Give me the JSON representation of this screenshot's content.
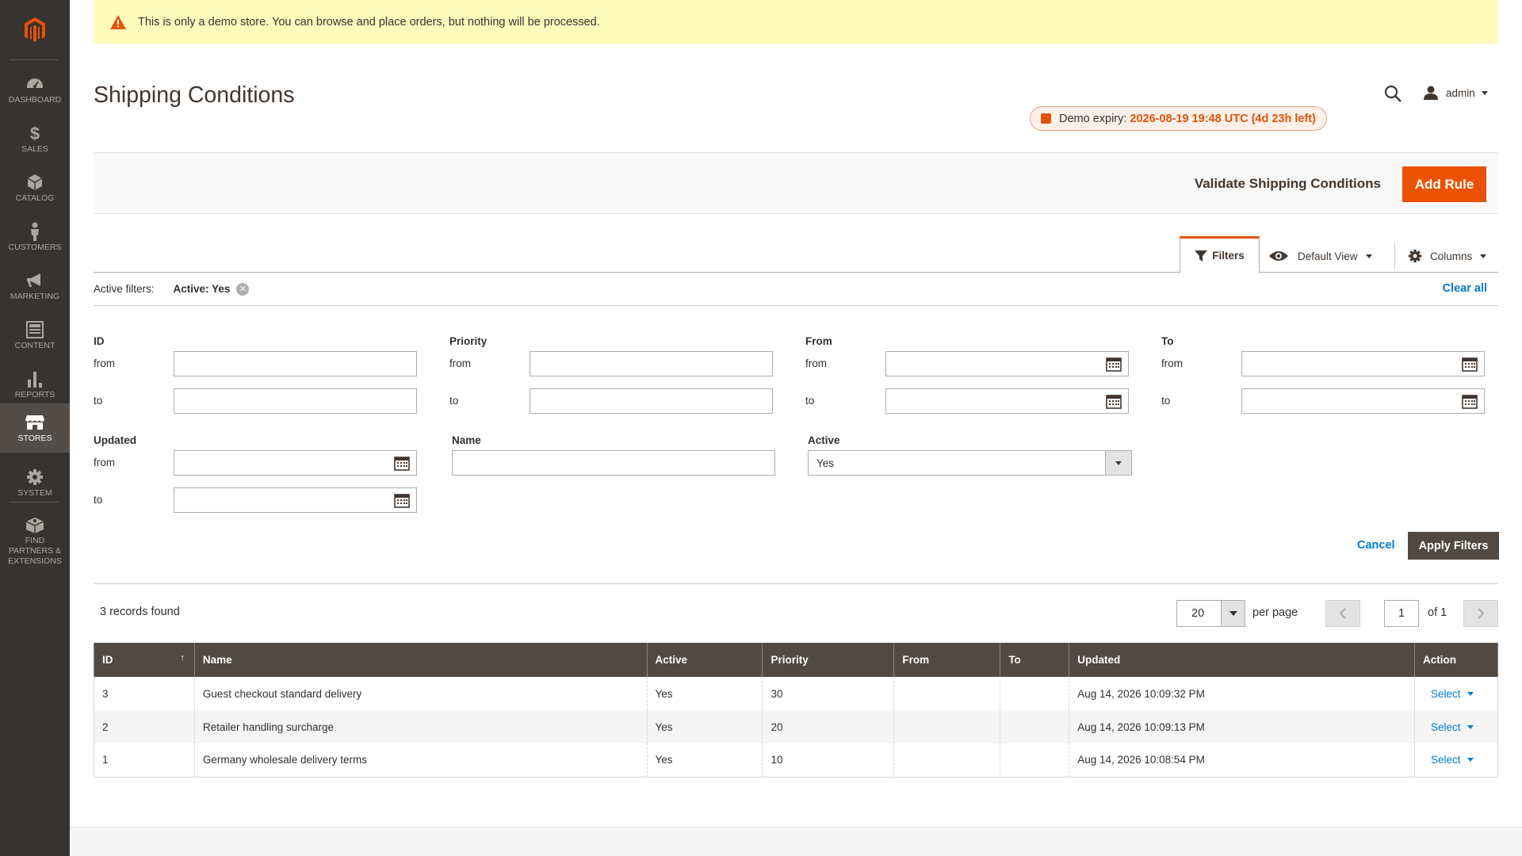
{
  "banner": {
    "text": "This is only a demo store. You can browse and place orders, but nothing will be processed."
  },
  "nav": [
    {
      "label": "DASHBOARD",
      "icon": "dashboard-icon"
    },
    {
      "label": "SALES",
      "icon": "dollar-icon"
    },
    {
      "label": "CATALOG",
      "icon": "cube-icon"
    },
    {
      "label": "CUSTOMERS",
      "icon": "person-icon"
    },
    {
      "label": "MARKETING",
      "icon": "megaphone-icon"
    },
    {
      "label": "CONTENT",
      "icon": "layout-icon"
    },
    {
      "label": "REPORTS",
      "icon": "bar-chart-icon"
    },
    {
      "label": "STORES",
      "icon": "store-icon",
      "active": true
    },
    {
      "label": "SYSTEM",
      "icon": "gear-icon"
    },
    {
      "label": "FIND PARTNERS & EXTENSIONS",
      "icon": "box-icon"
    }
  ],
  "header": {
    "title": "Shipping Conditions",
    "user": "admin",
    "expiry_prefix": "Demo expiry:",
    "expiry_value": "2026-08-19 19:48 UTC (4d 23h left)"
  },
  "actions": {
    "validate": "Validate Shipping Conditions",
    "add_rule": "Add Rule"
  },
  "toolbar": {
    "filters": "Filters",
    "default_view": "Default View",
    "columns": "Columns"
  },
  "active_filters": {
    "label": "Active filters:",
    "item": "Active: Yes",
    "clear_all": "Clear all"
  },
  "filters": {
    "id": {
      "label": "ID",
      "from": "from",
      "to": "to"
    },
    "priority": {
      "label": "Priority",
      "from": "from",
      "to": "to"
    },
    "from_date": {
      "label": "From",
      "from": "from",
      "to": "to"
    },
    "to_date": {
      "label": "To",
      "from": "from",
      "to": "to"
    },
    "updated": {
      "label": "Updated",
      "from": "from",
      "to": "to"
    },
    "name": {
      "label": "Name"
    },
    "active": {
      "label": "Active",
      "value": "Yes"
    },
    "cancel": "Cancel",
    "apply": "Apply Filters"
  },
  "pager": {
    "records": "3 records found",
    "per_page_value": "20",
    "per_page_label": "per page",
    "page": "1",
    "of": "of 1"
  },
  "grid": {
    "columns": [
      "ID",
      "Name",
      "Active",
      "Priority",
      "From",
      "To",
      "Updated",
      "Action"
    ],
    "rows": [
      {
        "id": "3",
        "name": "Guest checkout standard delivery",
        "active": "Yes",
        "priority": "30",
        "from": "",
        "to": "",
        "updated": "Aug 14, 2026 10:09:32 PM",
        "action": "Select"
      },
      {
        "id": "2",
        "name": "Retailer handling surcharge",
        "active": "Yes",
        "priority": "20",
        "from": "",
        "to": "",
        "updated": "Aug 14, 2026 10:09:13 PM",
        "action": "Select"
      },
      {
        "id": "1",
        "name": "Germany wholesale delivery terms",
        "active": "Yes",
        "priority": "10",
        "from": "",
        "to": "",
        "updated": "Aug 14, 2026 10:08:54 PM",
        "action": "Select"
      }
    ]
  },
  "colors": {
    "accent": "#eb5202",
    "sidebar": "#373330",
    "header_row": "#514943",
    "link": "#007bdb",
    "banner": "#fffbbb"
  }
}
